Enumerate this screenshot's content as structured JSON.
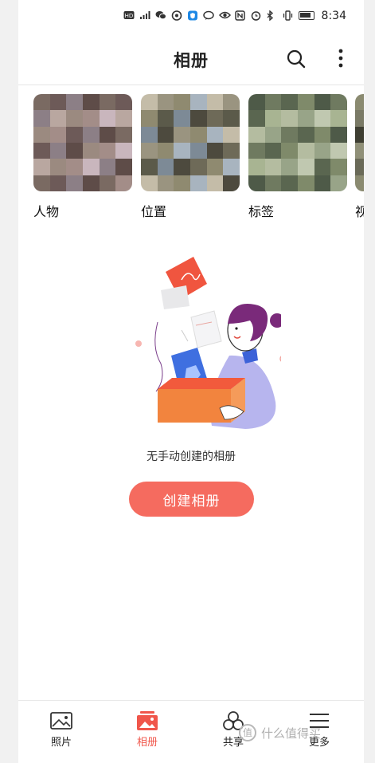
{
  "status_bar": {
    "time": "8:34",
    "icons": [
      "hd-icon",
      "signal-icon",
      "wechat-icon",
      "dialer-icon",
      "shield-icon",
      "chat-icon",
      "eye-icon",
      "nfc-icon",
      "alarm-icon",
      "bluetooth-icon",
      "vibrate-icon",
      "battery-icon"
    ]
  },
  "header": {
    "title": "相册",
    "search_icon": "search-icon",
    "more_icon": "more-vertical-icon"
  },
  "categories": [
    {
      "label": "人物"
    },
    {
      "label": "位置"
    },
    {
      "label": "标签"
    },
    {
      "label": "视"
    }
  ],
  "empty_state": {
    "text": "无手动创建的相册",
    "button": "创建相册"
  },
  "bottom_nav": [
    {
      "label": "照片",
      "icon": "image-icon",
      "active": false
    },
    {
      "label": "相册",
      "icon": "albums-icon",
      "active": true
    },
    {
      "label": "共享",
      "icon": "share-icon",
      "active": false
    },
    {
      "label": "更多",
      "icon": "menu-icon",
      "active": false
    }
  ],
  "watermark": {
    "text": "什么值得买",
    "icon_text": "值"
  },
  "colors": {
    "accent": "#f56b5f",
    "active_nav": "#f0564b"
  }
}
